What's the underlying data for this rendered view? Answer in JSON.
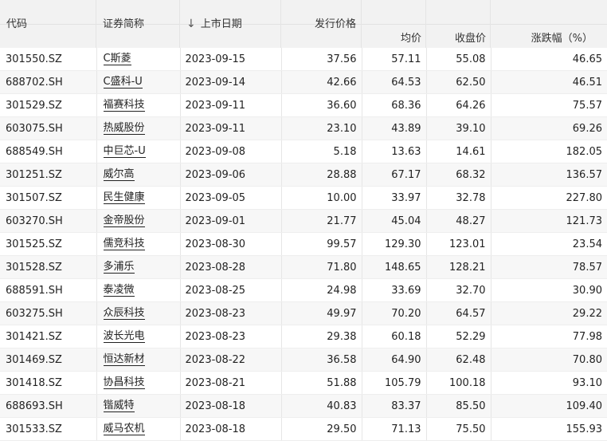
{
  "headers": {
    "code": "代码",
    "name": "证券简称",
    "date": "上市日期",
    "issue_price": "发行价格",
    "avg_price": "均价",
    "close_price": "收盘价",
    "change_pct": "涨跌幅（%）"
  },
  "sort_icon": "arrow-down-icon",
  "rows": [
    {
      "code": "301550.SZ",
      "name": "C斯菱",
      "date": "2023-09-15",
      "issue": "37.56",
      "avg": "57.11",
      "close": "55.08",
      "chg": "46.65"
    },
    {
      "code": "688702.SH",
      "name": "C盛科-U",
      "date": "2023-09-14",
      "issue": "42.66",
      "avg": "64.53",
      "close": "62.50",
      "chg": "46.51"
    },
    {
      "code": "301529.SZ",
      "name": "福赛科技",
      "date": "2023-09-11",
      "issue": "36.60",
      "avg": "68.36",
      "close": "64.26",
      "chg": "75.57"
    },
    {
      "code": "603075.SH",
      "name": "热威股份",
      "date": "2023-09-11",
      "issue": "23.10",
      "avg": "43.89",
      "close": "39.10",
      "chg": "69.26"
    },
    {
      "code": "688549.SH",
      "name": "中巨芯-U",
      "date": "2023-09-08",
      "issue": "5.18",
      "avg": "13.63",
      "close": "14.61",
      "chg": "182.05"
    },
    {
      "code": "301251.SZ",
      "name": "威尔高",
      "date": "2023-09-06",
      "issue": "28.88",
      "avg": "67.17",
      "close": "68.32",
      "chg": "136.57"
    },
    {
      "code": "301507.SZ",
      "name": "民生健康",
      "date": "2023-09-05",
      "issue": "10.00",
      "avg": "33.97",
      "close": "32.78",
      "chg": "227.80"
    },
    {
      "code": "603270.SH",
      "name": "金帝股份",
      "date": "2023-09-01",
      "issue": "21.77",
      "avg": "45.04",
      "close": "48.27",
      "chg": "121.73"
    },
    {
      "code": "301525.SZ",
      "name": "儒竞科技",
      "date": "2023-08-30",
      "issue": "99.57",
      "avg": "129.30",
      "close": "123.01",
      "chg": "23.54"
    },
    {
      "code": "301528.SZ",
      "name": "多浦乐",
      "date": "2023-08-28",
      "issue": "71.80",
      "avg": "148.65",
      "close": "128.21",
      "chg": "78.57"
    },
    {
      "code": "688591.SH",
      "name": "泰凌微",
      "date": "2023-08-25",
      "issue": "24.98",
      "avg": "33.69",
      "close": "32.70",
      "chg": "30.90"
    },
    {
      "code": "603275.SH",
      "name": "众辰科技",
      "date": "2023-08-23",
      "issue": "49.97",
      "avg": "70.20",
      "close": "64.57",
      "chg": "29.22"
    },
    {
      "code": "301421.SZ",
      "name": "波长光电",
      "date": "2023-08-23",
      "issue": "29.38",
      "avg": "60.18",
      "close": "52.29",
      "chg": "77.98"
    },
    {
      "code": "301469.SZ",
      "name": "恒达新材",
      "date": "2023-08-22",
      "issue": "36.58",
      "avg": "64.90",
      "close": "62.48",
      "chg": "70.80"
    },
    {
      "code": "301418.SZ",
      "name": "协昌科技",
      "date": "2023-08-21",
      "issue": "51.88",
      "avg": "105.79",
      "close": "100.18",
      "chg": "93.10"
    },
    {
      "code": "688693.SH",
      "name": "锴威特",
      "date": "2023-08-18",
      "issue": "40.83",
      "avg": "83.37",
      "close": "85.50",
      "chg": "109.40"
    },
    {
      "code": "301533.SZ",
      "name": "威马农机",
      "date": "2023-08-18",
      "issue": "29.50",
      "avg": "71.13",
      "close": "75.50",
      "chg": "155.93"
    }
  ]
}
